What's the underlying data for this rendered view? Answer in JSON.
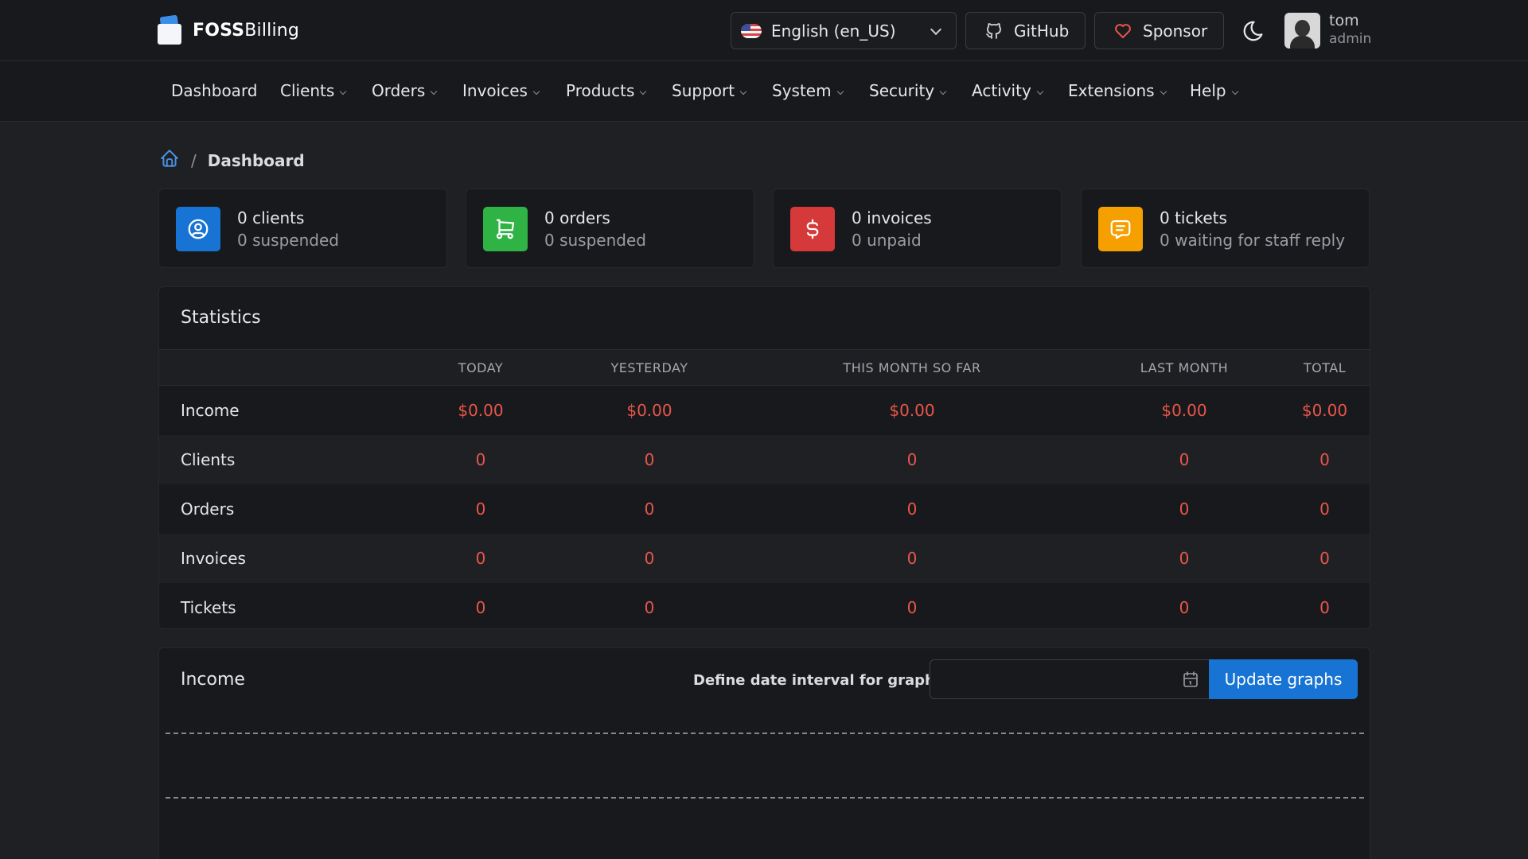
{
  "brand": {
    "bold": "FOSS",
    "regular": "Billing"
  },
  "header": {
    "language": "English (en_US)",
    "github_label": "GitHub",
    "sponsor_label": "Sponsor",
    "user_name": "tom",
    "user_role": "admin"
  },
  "nav": {
    "items": [
      "Dashboard",
      "Clients",
      "Orders",
      "Invoices",
      "Products",
      "Support",
      "System",
      "Security",
      "Activity",
      "Extensions",
      "Help"
    ]
  },
  "breadcrumb": {
    "current": "Dashboard"
  },
  "cards": [
    {
      "main": "0 clients",
      "sub": "0 suspended",
      "color": "#1774d4",
      "icon": "user-circle-icon"
    },
    {
      "main": "0 orders",
      "sub": "0 suspended",
      "color": "#2fb344",
      "icon": "shopping-cart-icon"
    },
    {
      "main": "0 invoices",
      "sub": "0 unpaid",
      "color": "#d63939",
      "icon": "dollar-icon"
    },
    {
      "main": "0 tickets",
      "sub": "0 waiting for staff reply",
      "color": "#f59f00",
      "icon": "message-icon"
    }
  ],
  "statistics": {
    "title": "Statistics",
    "columns": [
      "TODAY",
      "YESTERDAY",
      "THIS MONTH SO FAR",
      "LAST MONTH",
      "TOTAL"
    ],
    "rows": [
      {
        "label": "Income",
        "values": [
          "$0.00",
          "$0.00",
          "$0.00",
          "$0.00",
          "$0.00"
        ]
      },
      {
        "label": "Clients",
        "values": [
          "0",
          "0",
          "0",
          "0",
          "0"
        ]
      },
      {
        "label": "Orders",
        "values": [
          "0",
          "0",
          "0",
          "0",
          "0"
        ]
      },
      {
        "label": "Invoices",
        "values": [
          "0",
          "0",
          "0",
          "0",
          "0"
        ]
      },
      {
        "label": "Tickets",
        "values": [
          "0",
          "0",
          "0",
          "0",
          "0"
        ]
      }
    ]
  },
  "income": {
    "title": "Income",
    "interval_label": "Define date interval for graphs",
    "date_value": "",
    "update_label": "Update graphs"
  },
  "colors": {
    "accent": "#1774d4",
    "value_red": "#e8564b"
  }
}
